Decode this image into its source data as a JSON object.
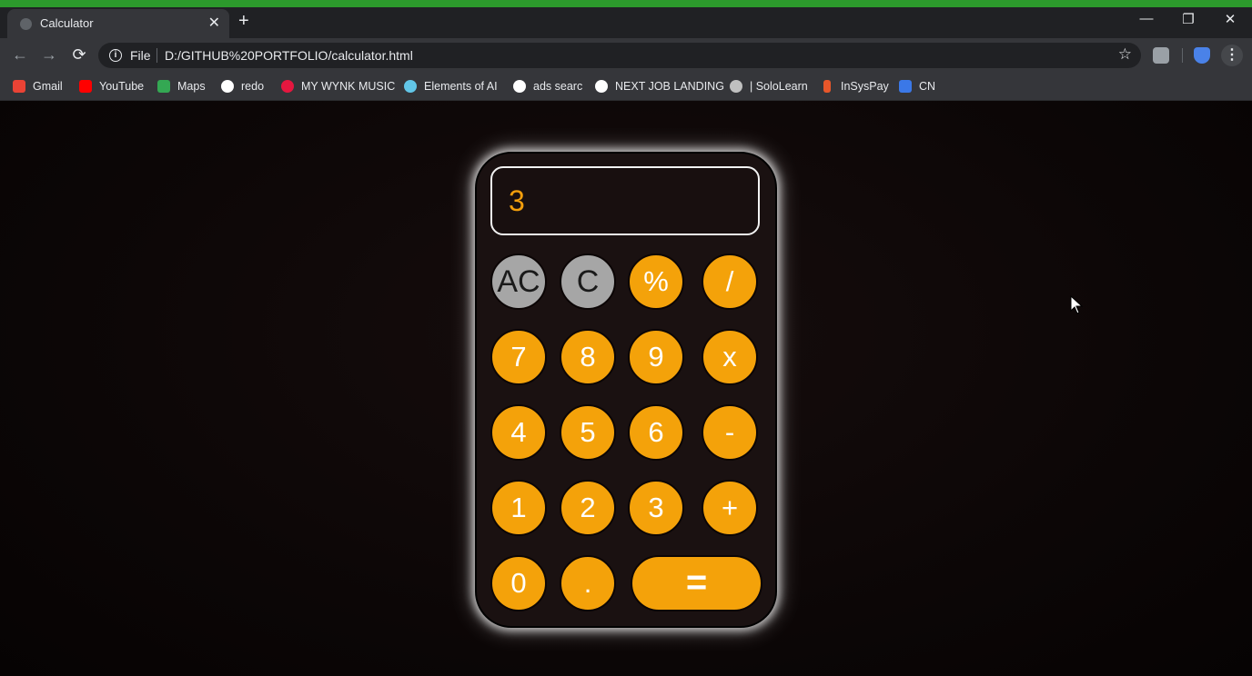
{
  "browser": {
    "tab_title": "Calculator",
    "tab_close": "✕",
    "new_tab": "+",
    "window_controls": {
      "minimize": "—",
      "restore": "❐",
      "close": "✕"
    },
    "address": {
      "scheme_label": "File",
      "url": "D:/GITHUB%20PORTFOLIO/calculator.html"
    },
    "nav": {
      "back": "←",
      "forward": "→",
      "reload": "⟳",
      "star": "☆",
      "menu": "⋮"
    },
    "accent_color": "#2c9a2c",
    "bookmarks": [
      {
        "label": "Gmail",
        "icon": "gmail-icon"
      },
      {
        "label": "YouTube",
        "icon": "youtube-icon"
      },
      {
        "label": "Maps",
        "icon": "maps-icon"
      },
      {
        "label": "redo",
        "icon": "google-icon"
      },
      {
        "label": "MY WYNK MUSIC",
        "icon": "wynk-icon"
      },
      {
        "label": "Elements of AI",
        "icon": "elements-ai-icon"
      },
      {
        "label": "ads searc",
        "icon": "google-icon"
      },
      {
        "label": "NEXT JOB LANDING",
        "icon": "google-icon"
      },
      {
        "label": "| SoloLearn",
        "icon": "sololearn-icon"
      },
      {
        "label": "InSysPay",
        "icon": "insyspay-icon"
      },
      {
        "label": "CN",
        "icon": "cn-icon"
      }
    ]
  },
  "calculator": {
    "display": "3",
    "keys": {
      "ac": "AC",
      "c": "C",
      "percent": "%",
      "divide": "/",
      "seven": "7",
      "eight": "8",
      "nine": "9",
      "multiply": "x",
      "four": "4",
      "five": "5",
      "six": "6",
      "minus": "-",
      "one": "1",
      "two": "2",
      "three": "3",
      "plus": "+",
      "zero": "0",
      "dot": ".",
      "equals": "="
    },
    "colors": {
      "key": "#f4a20a",
      "key_gray": "#a6a6a6",
      "display_text": "#f29e0c",
      "body": "#1a1111"
    }
  }
}
